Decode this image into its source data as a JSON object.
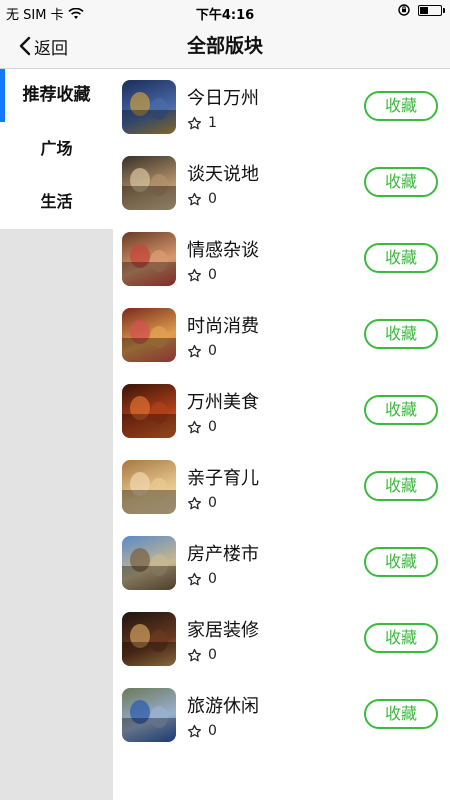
{
  "status_bar": {
    "carrier": "无 SIM 卡",
    "time": "下午4:16",
    "battery_level": 0.35,
    "icons": [
      "wifi-icon",
      "orientation-lock-icon",
      "battery-icon"
    ]
  },
  "nav": {
    "back_label": "返回",
    "title": "全部版块"
  },
  "sidebar": {
    "items": [
      {
        "label": "推荐收藏",
        "active": true
      },
      {
        "label": "广场",
        "active": false
      },
      {
        "label": "生活",
        "active": false
      }
    ]
  },
  "colors": {
    "accent_green": "#3cba40",
    "active_indicator": "#1477ff",
    "sidebar_bg": "#e3e3e3",
    "bar_bg": "#f7f7f7"
  },
  "boards": [
    {
      "name": "今日万州",
      "count": "1",
      "button_label": "收藏",
      "thumb_colors": [
        "#1a2d5a",
        "#4a6aa8",
        "#c9a040"
      ]
    },
    {
      "name": "谈天说地",
      "count": "0",
      "button_label": "收藏",
      "thumb_colors": [
        "#3a3128",
        "#b0906a",
        "#d9c4a0"
      ]
    },
    {
      "name": "情感杂谈",
      "count": "0",
      "button_label": "收藏",
      "thumb_colors": [
        "#6a3a22",
        "#d89a70",
        "#c8443a"
      ]
    },
    {
      "name": "时尚消费",
      "count": "0",
      "button_label": "收藏",
      "thumb_colors": [
        "#7a2a1a",
        "#e0a050",
        "#d65050"
      ]
    },
    {
      "name": "万州美食",
      "count": "0",
      "button_label": "收藏",
      "thumb_colors": [
        "#3a1408",
        "#b0401a",
        "#e07030"
      ]
    },
    {
      "name": "亲子育儿",
      "count": "0",
      "button_label": "收藏",
      "thumb_colors": [
        "#a87840",
        "#e8c890",
        "#f0d8b0"
      ]
    },
    {
      "name": "房产楼市",
      "count": "0",
      "button_label": "收藏",
      "thumb_colors": [
        "#5a8ac8",
        "#c8b890",
        "#7a6040"
      ]
    },
    {
      "name": "家居装修",
      "count": "0",
      "button_label": "收藏",
      "thumb_colors": [
        "#1e1410",
        "#6a3a20",
        "#d0a060"
      ]
    },
    {
      "name": "旅游休闲",
      "count": "0",
      "button_label": "收藏",
      "thumb_colors": [
        "#6a7a5a",
        "#9ab0d0",
        "#2a5ab0"
      ]
    }
  ]
}
